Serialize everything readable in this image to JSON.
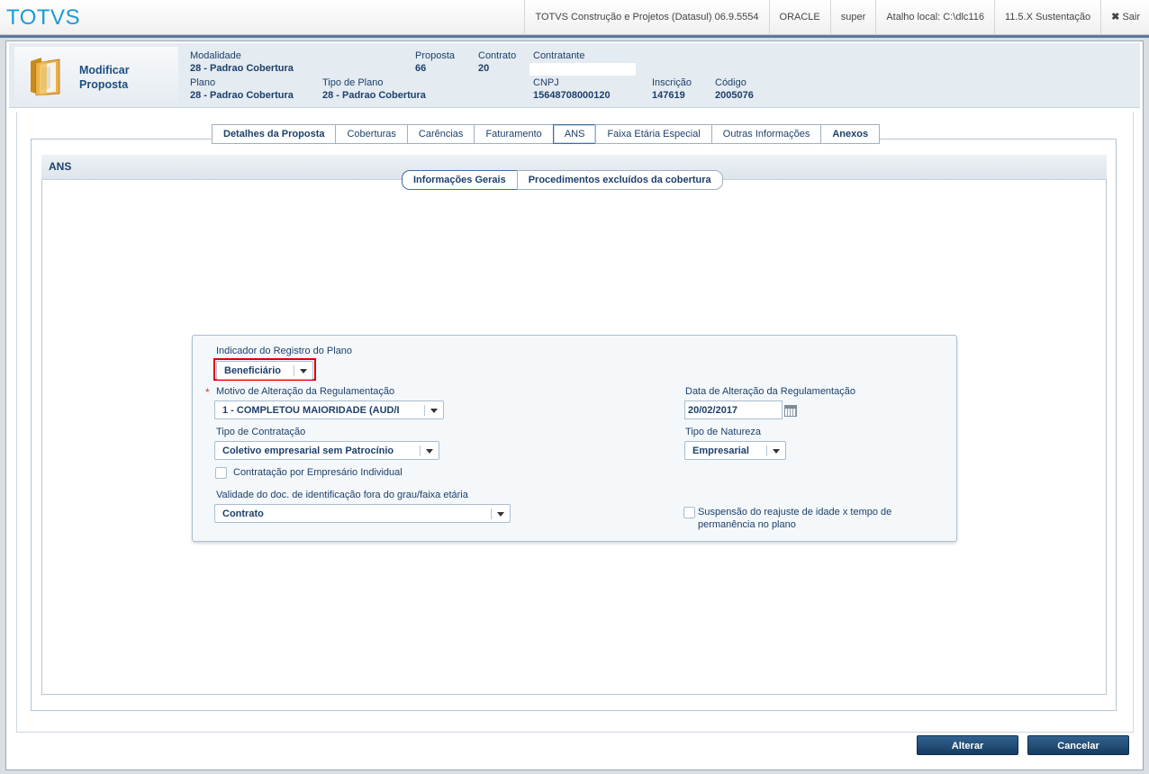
{
  "app": {
    "brand": "TOTVS"
  },
  "topnav": [
    "TOTVS Construção e Projetos (Datasul) 06.9.5554",
    "ORACLE",
    "super",
    "Atalho local: C:\\dlc116",
    "11.5.X Sustentação"
  ],
  "sair": {
    "icon": "close-icon",
    "label": "Sair"
  },
  "header": {
    "title_line1": "Modificar",
    "title_line2": "Proposta",
    "modalidade_label": "Modalidade",
    "modalidade_value": "28 - Padrao Cobertura",
    "proposta_label": "Proposta",
    "proposta_value": "66",
    "contrato_label": "Contrato",
    "contrato_value": "20",
    "contratante_label": "Contratante",
    "plano_label": "Plano",
    "plano_value": "28 - Padrao Cobertura",
    "tipo_plano_label": "Tipo de Plano",
    "tipo_plano_value": "28 - Padrao Cobertura",
    "cnpj_label": "CNPJ",
    "cnpj_value": "15648708000120",
    "inscricao_label": "Inscrição",
    "inscricao_value": "147619",
    "codigo_label": "Código",
    "codigo_value": "2005076"
  },
  "tabs": [
    {
      "label": "Detalhes da Proposta",
      "bold": true
    },
    {
      "label": "Coberturas",
      "bold": false
    },
    {
      "label": "Carências",
      "bold": false
    },
    {
      "label": "Faturamento",
      "bold": false
    },
    {
      "label": "ANS",
      "bold": false,
      "active": true
    },
    {
      "label": "Faixa Etária Especial",
      "bold": false
    },
    {
      "label": "Outras Informações",
      "bold": false
    },
    {
      "label": "Anexos",
      "bold": true
    }
  ],
  "section": {
    "title": "ANS"
  },
  "subtabs": [
    "Informações Gerais",
    "Procedimentos excluídos da cobertura"
  ],
  "form": {
    "indicador_label": "Indicador do Registro do Plano",
    "indicador_value": "Beneficiário",
    "motivo_required": "*",
    "motivo_label": "Motivo de Alteração da Regulamentação",
    "motivo_value": "1 - COMPLETOU MAIORIDADE (AUD/I",
    "data_label": "Data de Alteração da Regulamentação",
    "data_value": "20/02/2017",
    "tipo_contratacao_label": "Tipo de Contratação",
    "tipo_contratacao_value": "Coletivo empresarial sem Patrocínio",
    "tipo_natureza_label": "Tipo de Natureza",
    "tipo_natureza_value": "Empresarial",
    "empresario_label": "Contratação por Empresário Individual",
    "validade_label": "Validade do doc. de identificação fora do grau/faixa etária",
    "validade_value": "Contrato",
    "suspensao_line1": "Suspensão do reajuste de idade x tempo de",
    "suspensao_line2": "permanência no plano"
  },
  "buttons": {
    "alterar": "Alterar",
    "cancelar": "Cancelar"
  },
  "colors": {
    "brand": "#1a9bd7",
    "primary_button": "#1e4a74",
    "highlight": "#e00000"
  }
}
